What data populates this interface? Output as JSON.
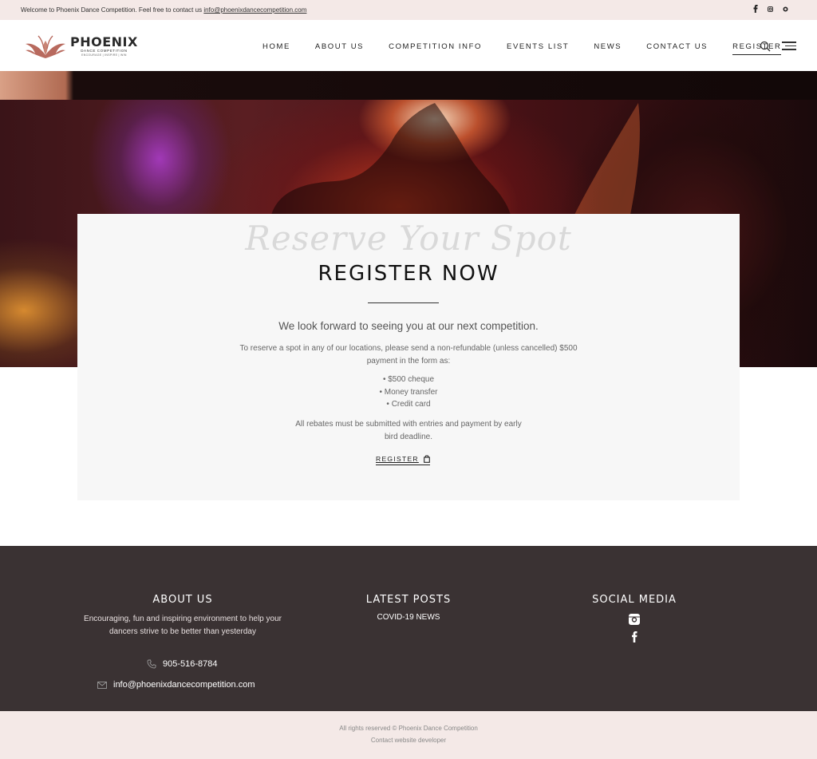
{
  "topbar": {
    "welcome_text": "Welcome to Phoenix Dance Competition. Feel free to contact us",
    "email_link": "info@phoenixdancecompetition.com",
    "social_icons": [
      "facebook-icon",
      "instagram-icon",
      "whatsapp-icon"
    ]
  },
  "header": {
    "brand_name": "PHOENIX",
    "brand_sub": "DANCE COMPETITION",
    "brand_tagline": "ENCOURAGE | INSPIRE | WIN",
    "nav": [
      {
        "label": "HOME"
      },
      {
        "label": "ABOUT US"
      },
      {
        "label": "COMPETITION INFO"
      },
      {
        "label": "EVENTS LIST"
      },
      {
        "label": "NEWS"
      },
      {
        "label": "CONTACT US"
      },
      {
        "label": "REGISTER"
      }
    ]
  },
  "register": {
    "script_title": "Reserve Your Spot",
    "title": "REGISTER NOW",
    "lead": "We look forward to seeing you at our next competition.",
    "paragraph": "To reserve a spot in any of our locations, please send a non-refundable (unless cancelled) $500 payment in the form as:",
    "payment_options": [
      "$500 cheque",
      "Money transfer",
      "Credit card"
    ],
    "note": "All rebates must be submitted with entries and payment by early bird deadline.",
    "button_label": "REGISTER"
  },
  "footer": {
    "about_title": "ABOUT US",
    "about_text": "Encouraging, fun and inspiring environment to help your dancers strive to be better than yesterday",
    "phone": "905-516-8784",
    "email": "info@phoenixdancecompetition.com",
    "posts_title": "LATEST POSTS",
    "posts": [
      "COVID-19 NEWS"
    ],
    "social_title": "SOCIAL MEDIA"
  },
  "bottombar": {
    "copyright": "All rights reserved © Phoenix Dance Competition",
    "developer_link": "Contact website developer"
  },
  "colors": {
    "topbar_bg": "#f4e9e7",
    "footer_bg": "#3a3233",
    "card_bg": "#f7f7f7",
    "logo_accent": "#b86a5e"
  }
}
